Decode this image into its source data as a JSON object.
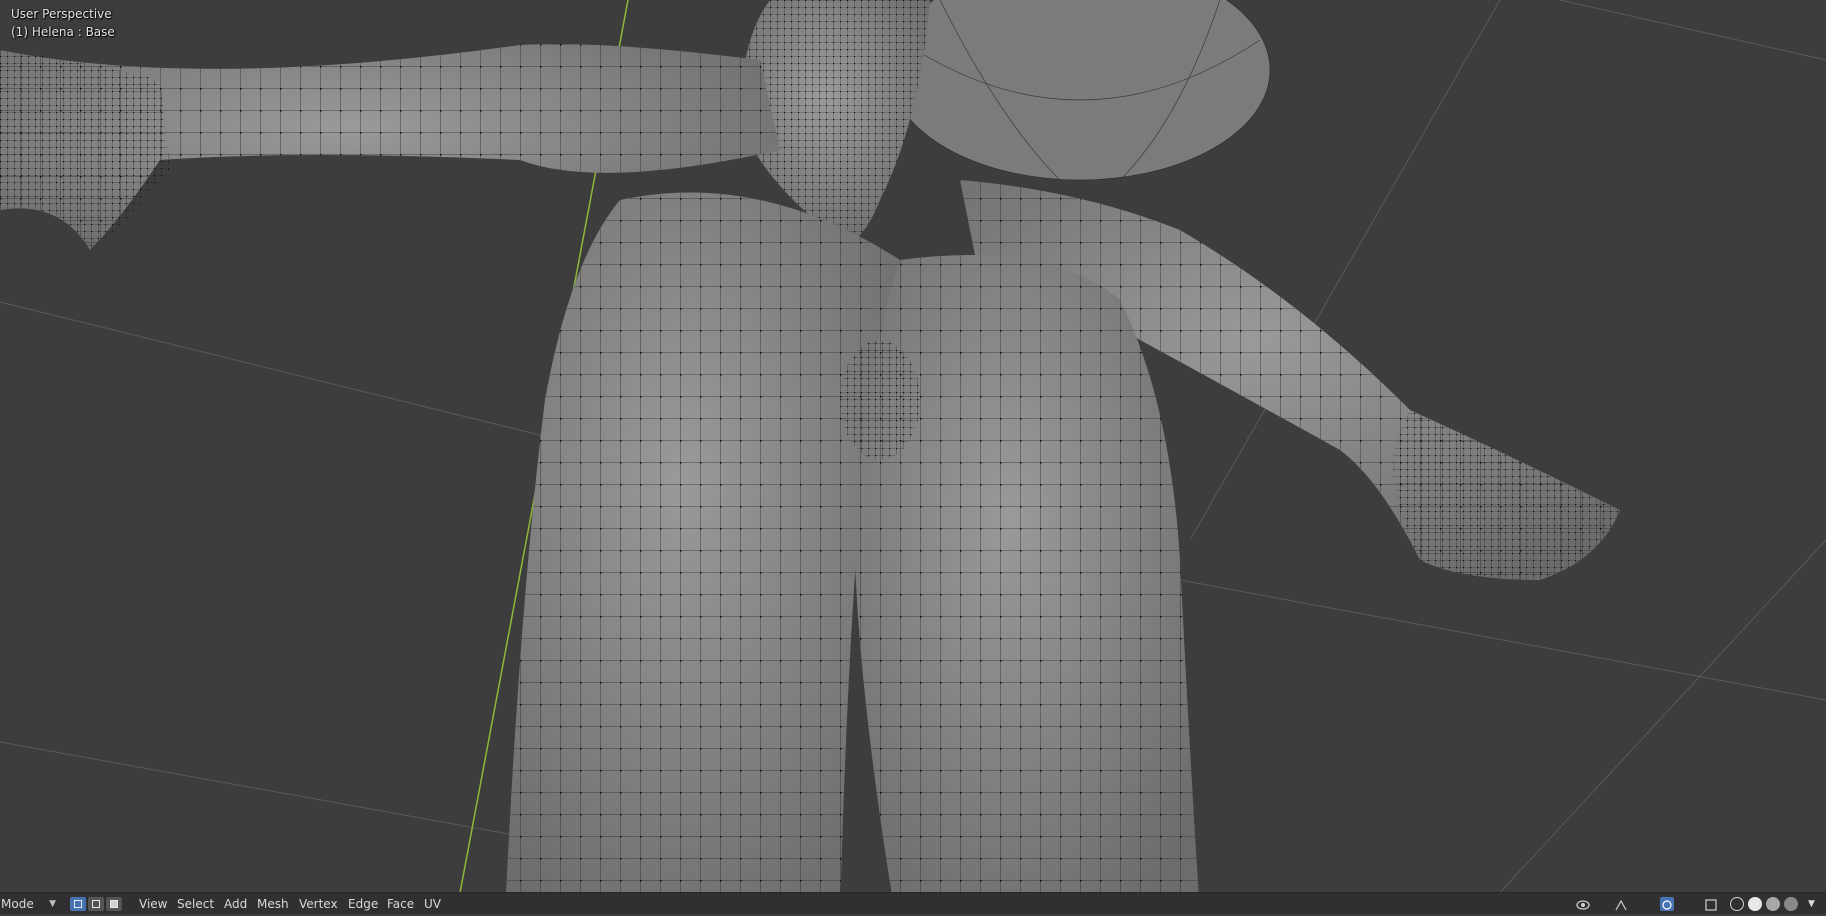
{
  "viewport": {
    "overlay_line1": "User Perspective",
    "overlay_line2": "(1) Helena : Base"
  },
  "footer": {
    "mode_label": "Mode",
    "menu": {
      "view": "View",
      "select": "Select",
      "add": "Add",
      "mesh": "Mesh",
      "vertex": "Vertex",
      "edge": "Edge",
      "face": "Face",
      "uv": "UV"
    }
  },
  "colors": {
    "background": "#3d3d3d",
    "mesh": "#8a8a8a",
    "wire": "#1e1e1e",
    "axis_y": "#8fb83b",
    "header": "#303030",
    "accent": "#4772b3"
  },
  "icons": {
    "vertex_select": "vertex-select-icon",
    "edge_select": "edge-select-icon",
    "face_select": "face-select-icon",
    "visibility": "eye-icon",
    "gizmo": "gizmo-icon",
    "overlay": "overlay-icon",
    "xray": "xray-icon",
    "wireframe": "wireframe-shading-icon",
    "solid": "solid-shading-icon",
    "material": "material-shading-icon",
    "rendered": "rendered-shading-icon"
  }
}
